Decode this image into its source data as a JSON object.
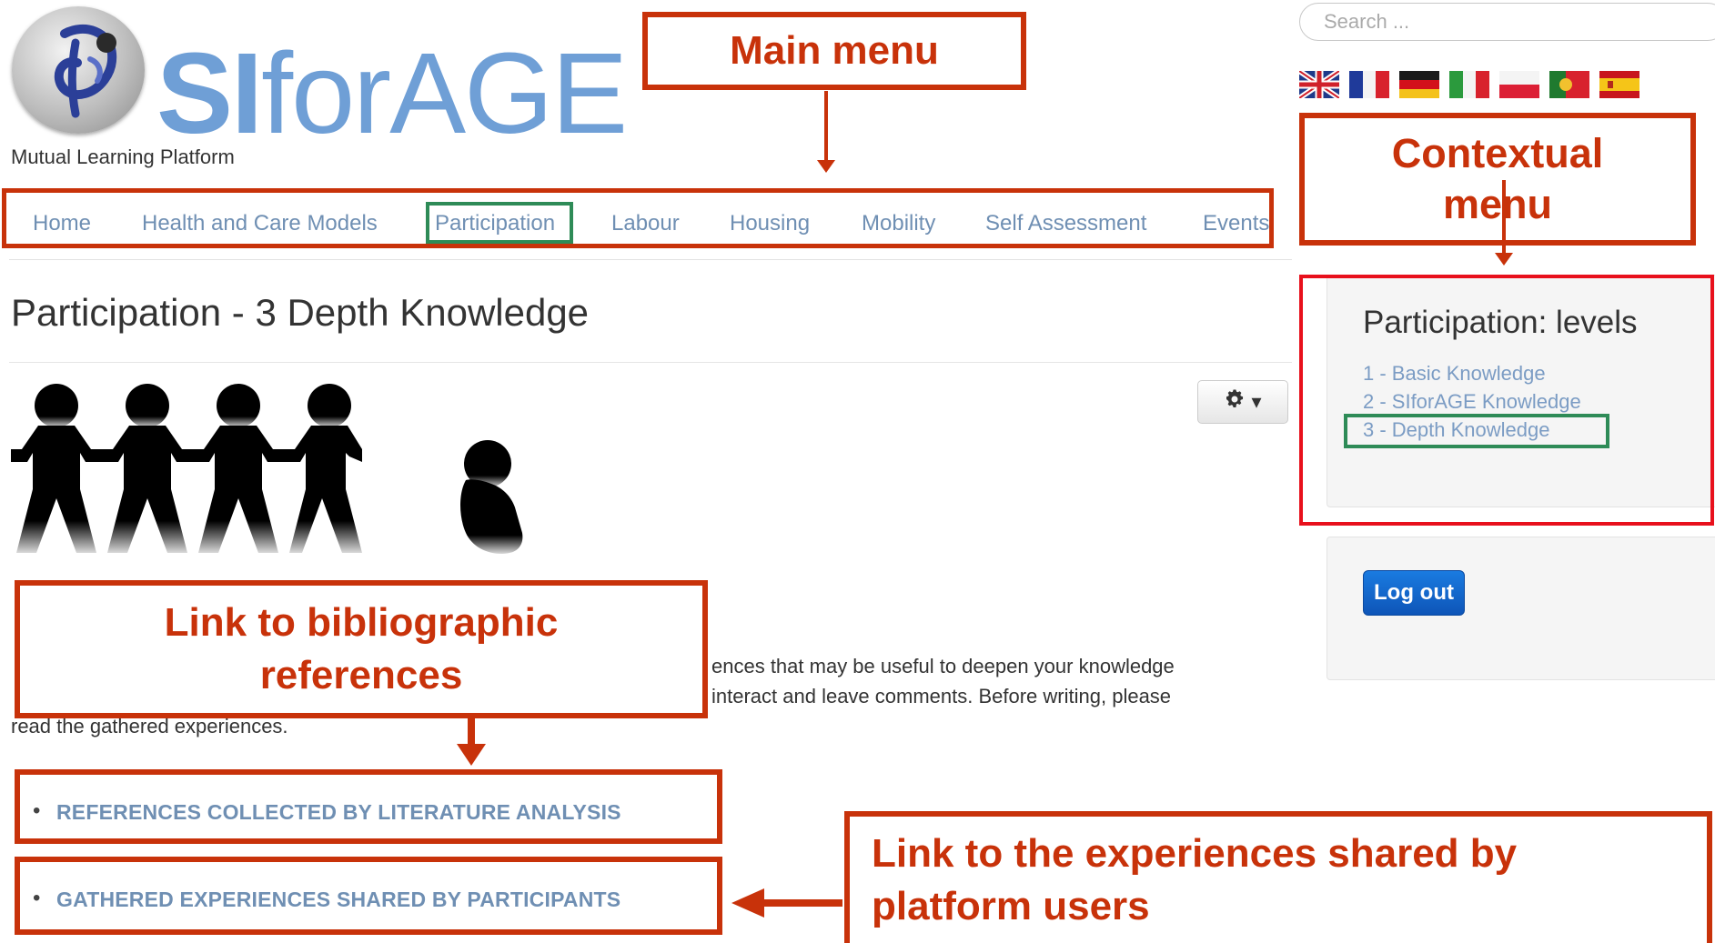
{
  "header": {
    "logo_prefix": "SI",
    "logo_suffix": "forAGE",
    "tagline": "Mutual Learning Platform"
  },
  "search": {
    "placeholder": "Search ..."
  },
  "languages": [
    "english-flag",
    "french-flag",
    "german-flag",
    "italian-flag",
    "polish-flag",
    "portuguese-flag",
    "spanish-flag"
  ],
  "nav": {
    "items": [
      "Home",
      "Health and Care Models",
      "Participation",
      "Labour",
      "Housing",
      "Mobility",
      "Self Assessment",
      "Events"
    ]
  },
  "main": {
    "title": "Participation - 3 Depth Knowledge",
    "body_line1": "ences that may be useful to deepen your knowledge",
    "body_line2": "interact and leave comments. Before writing, please",
    "body_line3": "read the gathered experiences.",
    "links": [
      "REFERENCES COLLECTED BY LITERATURE ANALYSIS",
      "GATHERED EXPERIENCES SHARED BY PARTICIPANTS"
    ]
  },
  "sidebar": {
    "levels_title": "Participation: levels",
    "levels": [
      "1 - Basic Knowledge",
      "2 - SIforAGE Knowledge",
      "3 - Depth Knowledge"
    ],
    "logout_label": "Log out"
  },
  "annotations": {
    "main_menu": "Main menu",
    "contextual_menu": "Contextual menu",
    "biblio": "Link to bibliographic references",
    "experiences": "Link to the experiences shared by platform users"
  },
  "colors": {
    "annotation": "#c8320a",
    "highlight_green": "#2e8b57",
    "link": "#6f8fb3",
    "logo": "#6f9fd6",
    "logout_button": "#1a6fd6"
  }
}
